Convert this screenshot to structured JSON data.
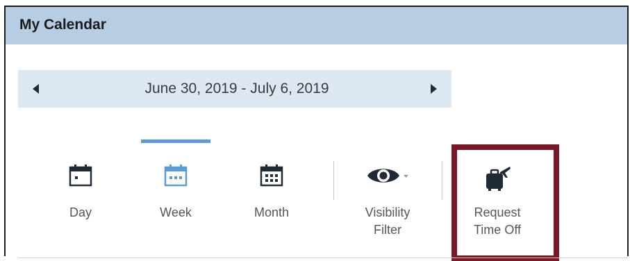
{
  "header": {
    "title": "My Calendar"
  },
  "date_nav": {
    "prev_icon": "triangle-left-icon",
    "next_icon": "triangle-right-icon",
    "range": "June 30, 2019 - July 6, 2019"
  },
  "view_buttons": {
    "day": {
      "label": "Day",
      "icon": "calendar-day-icon"
    },
    "week": {
      "label": "Week",
      "icon": "calendar-week-icon",
      "active": true
    },
    "month": {
      "label": "Month",
      "icon": "calendar-month-icon"
    },
    "visibility": {
      "label": "Visibility\nFilter",
      "icon": "eye-icon"
    },
    "time_off": {
      "label": "Request\nTime Off",
      "icon": "luggage-plane-icon"
    }
  },
  "colors": {
    "header_bg": "#b7cde3",
    "nav_bg": "#dde8f3",
    "active_accent": "#5b9bd5",
    "icon_dark": "#1f2a36",
    "highlight": "#7a1828"
  }
}
